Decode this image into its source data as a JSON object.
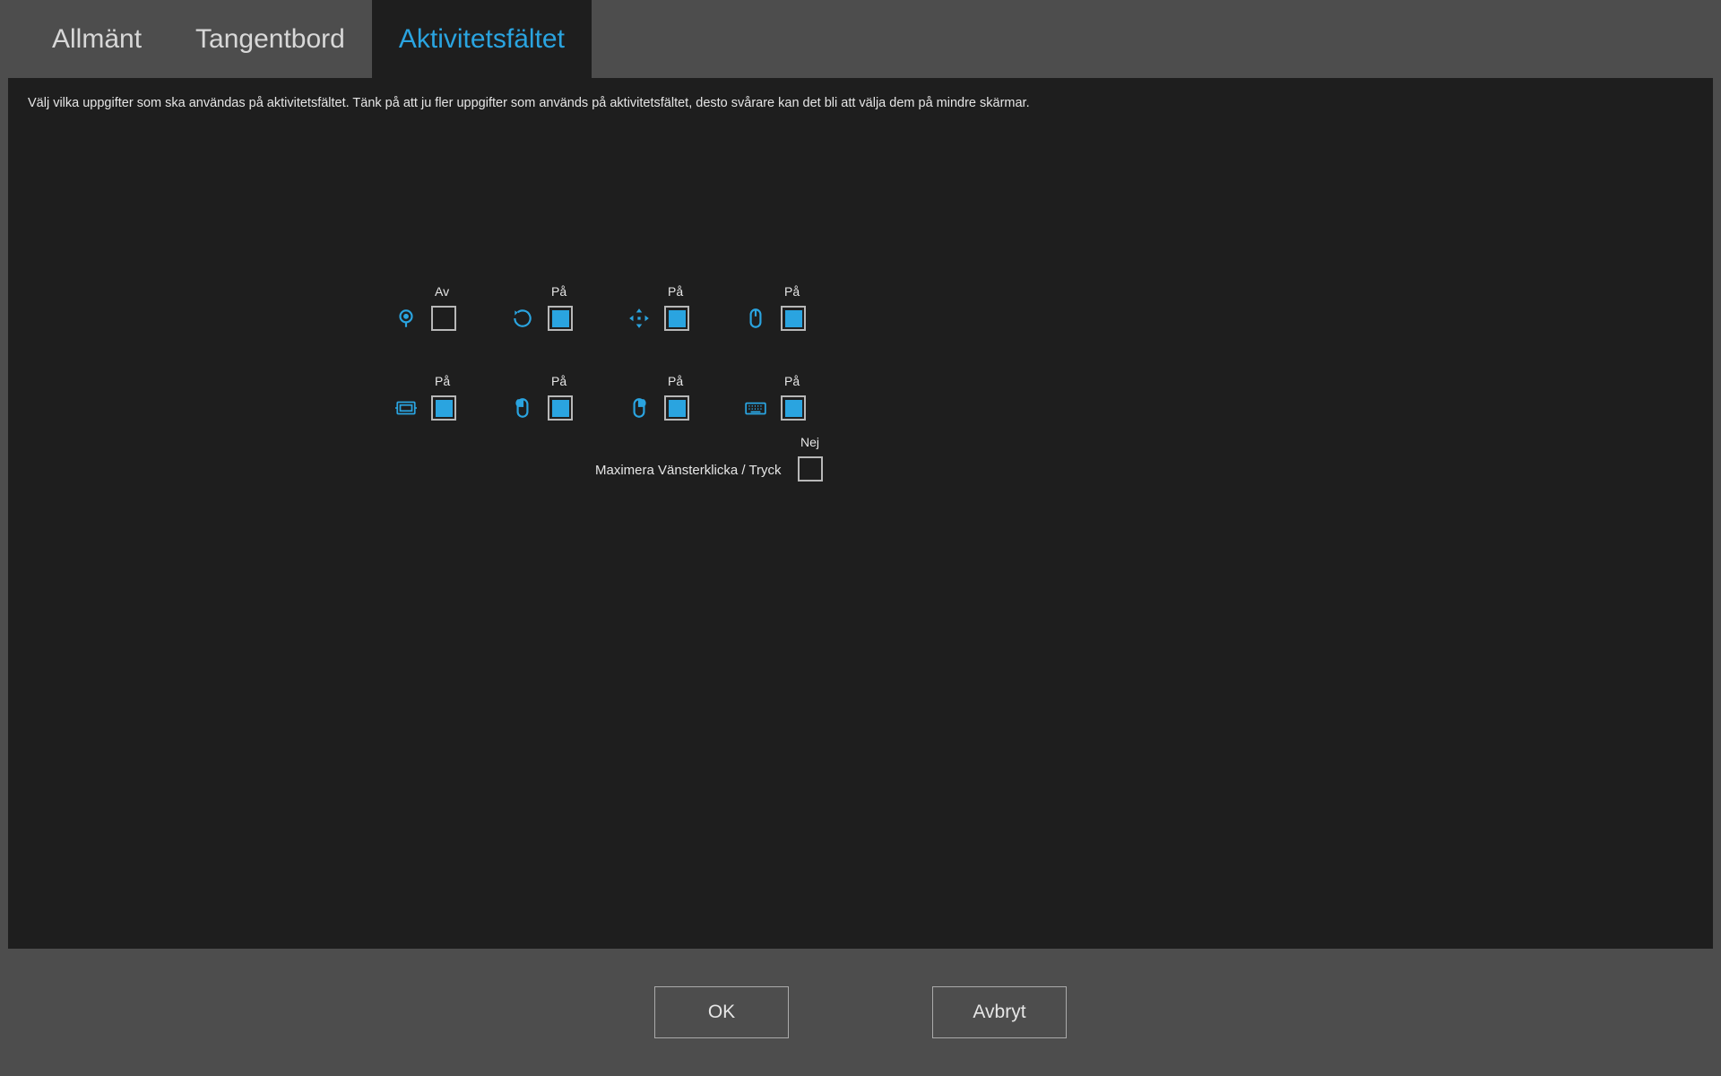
{
  "tabs": {
    "general": "Allmänt",
    "keyboard": "Tangentbord",
    "taskbar": "Aktivitetsfältet"
  },
  "description": "Välj vilka uppgifter som ska användas på aktivitetsfältet. Tänk på att ju fler uppgifter som används på aktivitetsfältet, desto svårare kan det bli att välja dem på mindre skärmar.",
  "labels": {
    "off": "Av",
    "on": "På",
    "no": "Nej"
  },
  "toggles": [
    {
      "icon": "place-marker-icon",
      "state": "off"
    },
    {
      "icon": "refresh-icon",
      "state": "on"
    },
    {
      "icon": "move-icon",
      "state": "on"
    },
    {
      "icon": "mouse-icon",
      "state": "on"
    },
    {
      "icon": "calibrate-icon",
      "state": "on"
    },
    {
      "icon": "mouse-left-icon",
      "state": "on"
    },
    {
      "icon": "mouse-right-icon",
      "state": "on"
    },
    {
      "icon": "keyboard-icon",
      "state": "on"
    }
  ],
  "maximize": {
    "label": "Maximera Vänsterklicka / Tryck",
    "state": "no"
  },
  "buttons": {
    "ok": "OK",
    "cancel": "Avbryt"
  },
  "colors": {
    "accent": "#2aa4e0",
    "panel": "#1e1e1e",
    "chrome": "#4d4d4d"
  }
}
